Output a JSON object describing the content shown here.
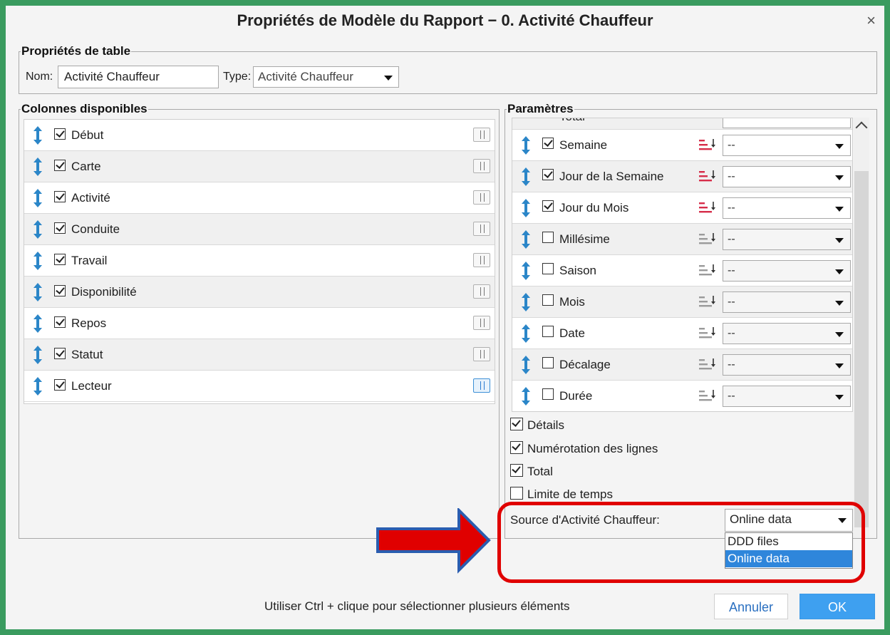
{
  "window": {
    "title": "Propriétés de Modèle du Rapport − 0. Activité Chauffeur",
    "close_glyph": "×"
  },
  "table_props": {
    "legend": "Propriétés de table",
    "name_label": "Nom:",
    "name_value": "Activité Chauffeur",
    "type_label": "Type:",
    "type_value": "Activité Chauffeur"
  },
  "available_columns": {
    "legend": "Colonnes disponibles",
    "items": [
      {
        "label": "Début",
        "checked": true
      },
      {
        "label": "Carte",
        "checked": true
      },
      {
        "label": "Activité",
        "checked": true
      },
      {
        "label": "Conduite",
        "checked": true
      },
      {
        "label": "Travail",
        "checked": true
      },
      {
        "label": "Disponibilité",
        "checked": true
      },
      {
        "label": "Repos",
        "checked": true
      },
      {
        "label": "Statut",
        "checked": true
      },
      {
        "label": "Lecteur",
        "checked": true
      }
    ]
  },
  "parameters": {
    "legend": "Paramètres",
    "cut_row_label": "Total",
    "rows": [
      {
        "label": "Semaine",
        "checked": true,
        "sort_active": true,
        "value": "--"
      },
      {
        "label": "Jour de la Semaine",
        "checked": true,
        "sort_active": true,
        "value": "--"
      },
      {
        "label": "Jour du Mois",
        "checked": true,
        "sort_active": true,
        "value": "--"
      },
      {
        "label": "Millésime",
        "checked": false,
        "sort_active": false,
        "value": "--"
      },
      {
        "label": "Saison",
        "checked": false,
        "sort_active": false,
        "value": "--"
      },
      {
        "label": "Mois",
        "checked": false,
        "sort_active": false,
        "value": "--"
      },
      {
        "label": "Date",
        "checked": false,
        "sort_active": false,
        "value": "--"
      },
      {
        "label": "Décalage",
        "checked": false,
        "sort_active": false,
        "value": "--"
      },
      {
        "label": "Durée",
        "checked": false,
        "sort_active": false,
        "value": "--"
      }
    ],
    "options": [
      {
        "label": "Détails",
        "checked": true
      },
      {
        "label": "Numérotation des lignes",
        "checked": true
      },
      {
        "label": "Total",
        "checked": true
      },
      {
        "label": "Limite de temps",
        "checked": false
      }
    ],
    "source_label": "Source d'Activité Chauffeur:",
    "source_value": "Online data",
    "source_options": [
      "DDD files",
      "Online data"
    ]
  },
  "footer": {
    "hint": "Utiliser Ctrl + clique pour sélectionner plusieurs éléments",
    "cancel_label": "Annuler",
    "ok_label": "OK"
  },
  "colors": {
    "frame": "#3a9b5f",
    "accent": "#3ea0f0",
    "highlight_red": "#e00000",
    "sort_active": "#d62d4a",
    "updown_icon": "#2b86c8"
  }
}
